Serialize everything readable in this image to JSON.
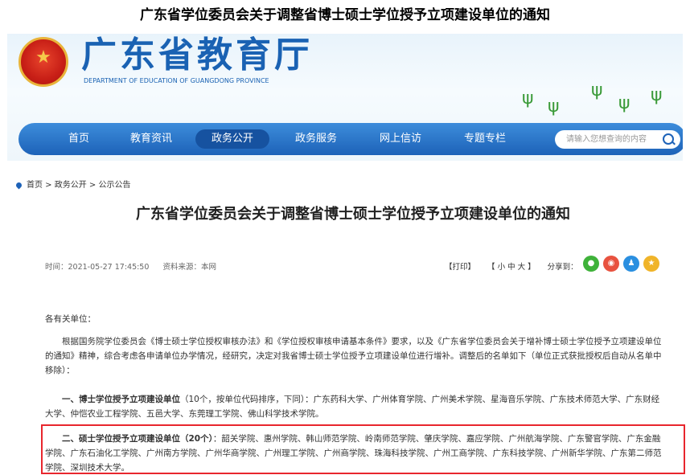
{
  "page_caption": "广东省学位委员会关于调整省博士硕士学位授予立项建设单位的通知",
  "header": {
    "dept_name_cn": "广东省教育厅",
    "dept_name_en": "DEPARTMENT OF EDUCATION OF GUANGDONG PROVINCE"
  },
  "nav": {
    "items": [
      "首页",
      "教育资讯",
      "政务公开",
      "政务服务",
      "网上信访",
      "专题专栏"
    ],
    "active_item": "政务公开",
    "search_placeholder": "请输入您想查询的内容"
  },
  "breadcrumb": "首页 > 政务公开 > 公示公告",
  "article": {
    "title": "广东省学位委员会关于调整省博士硕士学位授予立项建设单位的通知",
    "time": "时间：2021-05-27 17:45:50",
    "source": "资料来源：本网",
    "print": "【打印】",
    "font_size": "【 小  中  大 】",
    "share_label": "分享到：",
    "greeting": "各有关单位：",
    "para1": "根据国务院学位委员会《博士硕士学位授权审核办法》和《学位授权审核申请基本条件》要求，以及《广东省学位委员会关于增补博士硕士学位授予立项建设单位的通知》精神，综合考虑各申请单位办学情况，经研究，决定对我省博士硕士学位授予立项建设单位进行增补。调整后的名单如下（单位正式获批授权后自动从名单中移除）：",
    "section1_heading": "一、博士学位授予立项建设单位",
    "section1_count": "（10个，按单位代码排序，下同）：",
    "section1_list": "广东药科大学、广州体育学院、广州美术学院、星海音乐学院、广东技术师范大学、广东财经大学、仲恺农业工程学院、五邑大学、东莞理工学院、佛山科学技术学院。",
    "section2_heading": "二、硕士学位授予立项建设单位（20个）",
    "section2_list": "：韶关学院、惠州学院、韩山师范学院、岭南师范学院、肇庆学院、嘉应学院、广州航海学院、广东警官学院、广东金融学院、广东石油化工学院、广州南方学院、广州华商学院、广州理工学院、广州商学院、珠海科技学院、广州工商学院、广东科技学院、广州新华学院、广东第二师范学院、深圳技术大学。"
  },
  "colors": {
    "brand_blue": "#1a62b3",
    "highlight_red": "#e8262d",
    "share_wechat": "#3fb23a",
    "share_weibo": "#e8523f",
    "share_qq": "#2a8fe0",
    "share_qzone": "#f0b429"
  },
  "icons": [
    "national-emblem-icon",
    "search-icon",
    "location-pin-icon",
    "wechat-icon",
    "weibo-icon",
    "qq-icon",
    "qzone-icon"
  ]
}
